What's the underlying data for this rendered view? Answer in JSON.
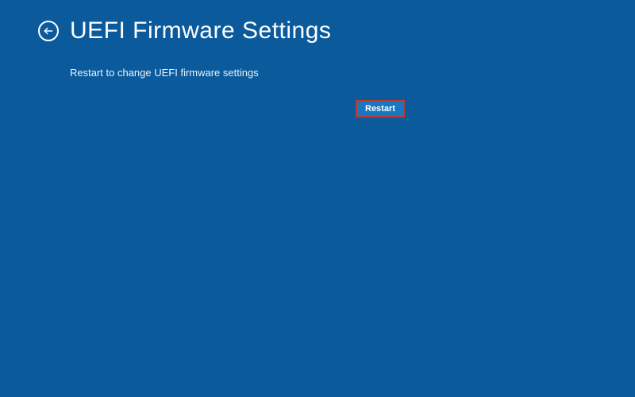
{
  "header": {
    "title": "UEFI Firmware Settings"
  },
  "main": {
    "description": "Restart to change UEFI firmware settings",
    "restart_label": "Restart"
  }
}
